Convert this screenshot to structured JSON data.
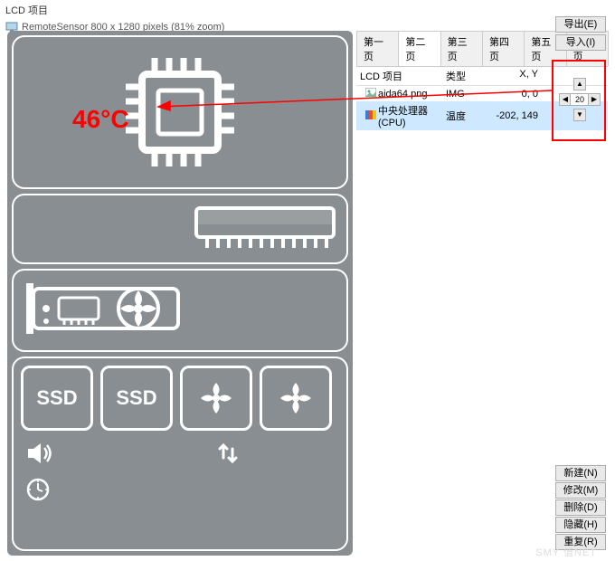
{
  "window": {
    "title": "LCD 项目"
  },
  "document": {
    "label": "RemoteSensor 800 x 1280 pixels (81% zoom)"
  },
  "preview": {
    "cpu_temp": "46°C",
    "ssd1": "SSD",
    "ssd2": "SSD"
  },
  "tabs": [
    "第一页",
    "第二页",
    "第三页",
    "第四页",
    "第五页",
    "第六页"
  ],
  "active_tab": 1,
  "list": {
    "headers": {
      "item": "LCD 项目",
      "type": "类型",
      "xy": "X, Y"
    },
    "rows": [
      {
        "label": "aida64.png",
        "type": "IMG",
        "xy": "0, 0",
        "icon": "image",
        "selected": false
      },
      {
        "label": "中央处理器(CPU)",
        "type": "温度",
        "xy": "-202, 149",
        "icon": "sensor",
        "selected": true
      }
    ]
  },
  "nudge": {
    "value": "20 px"
  },
  "buttons_top": {
    "export": "导出(E)",
    "import": "导入(I)"
  },
  "buttons_bottom": {
    "new": "新建(N)",
    "modify": "修改(M)",
    "delete": "删除(D)",
    "hide": "隐藏(H)",
    "duplicate": "重复(R)"
  },
  "watermark": "SMY 值NET"
}
